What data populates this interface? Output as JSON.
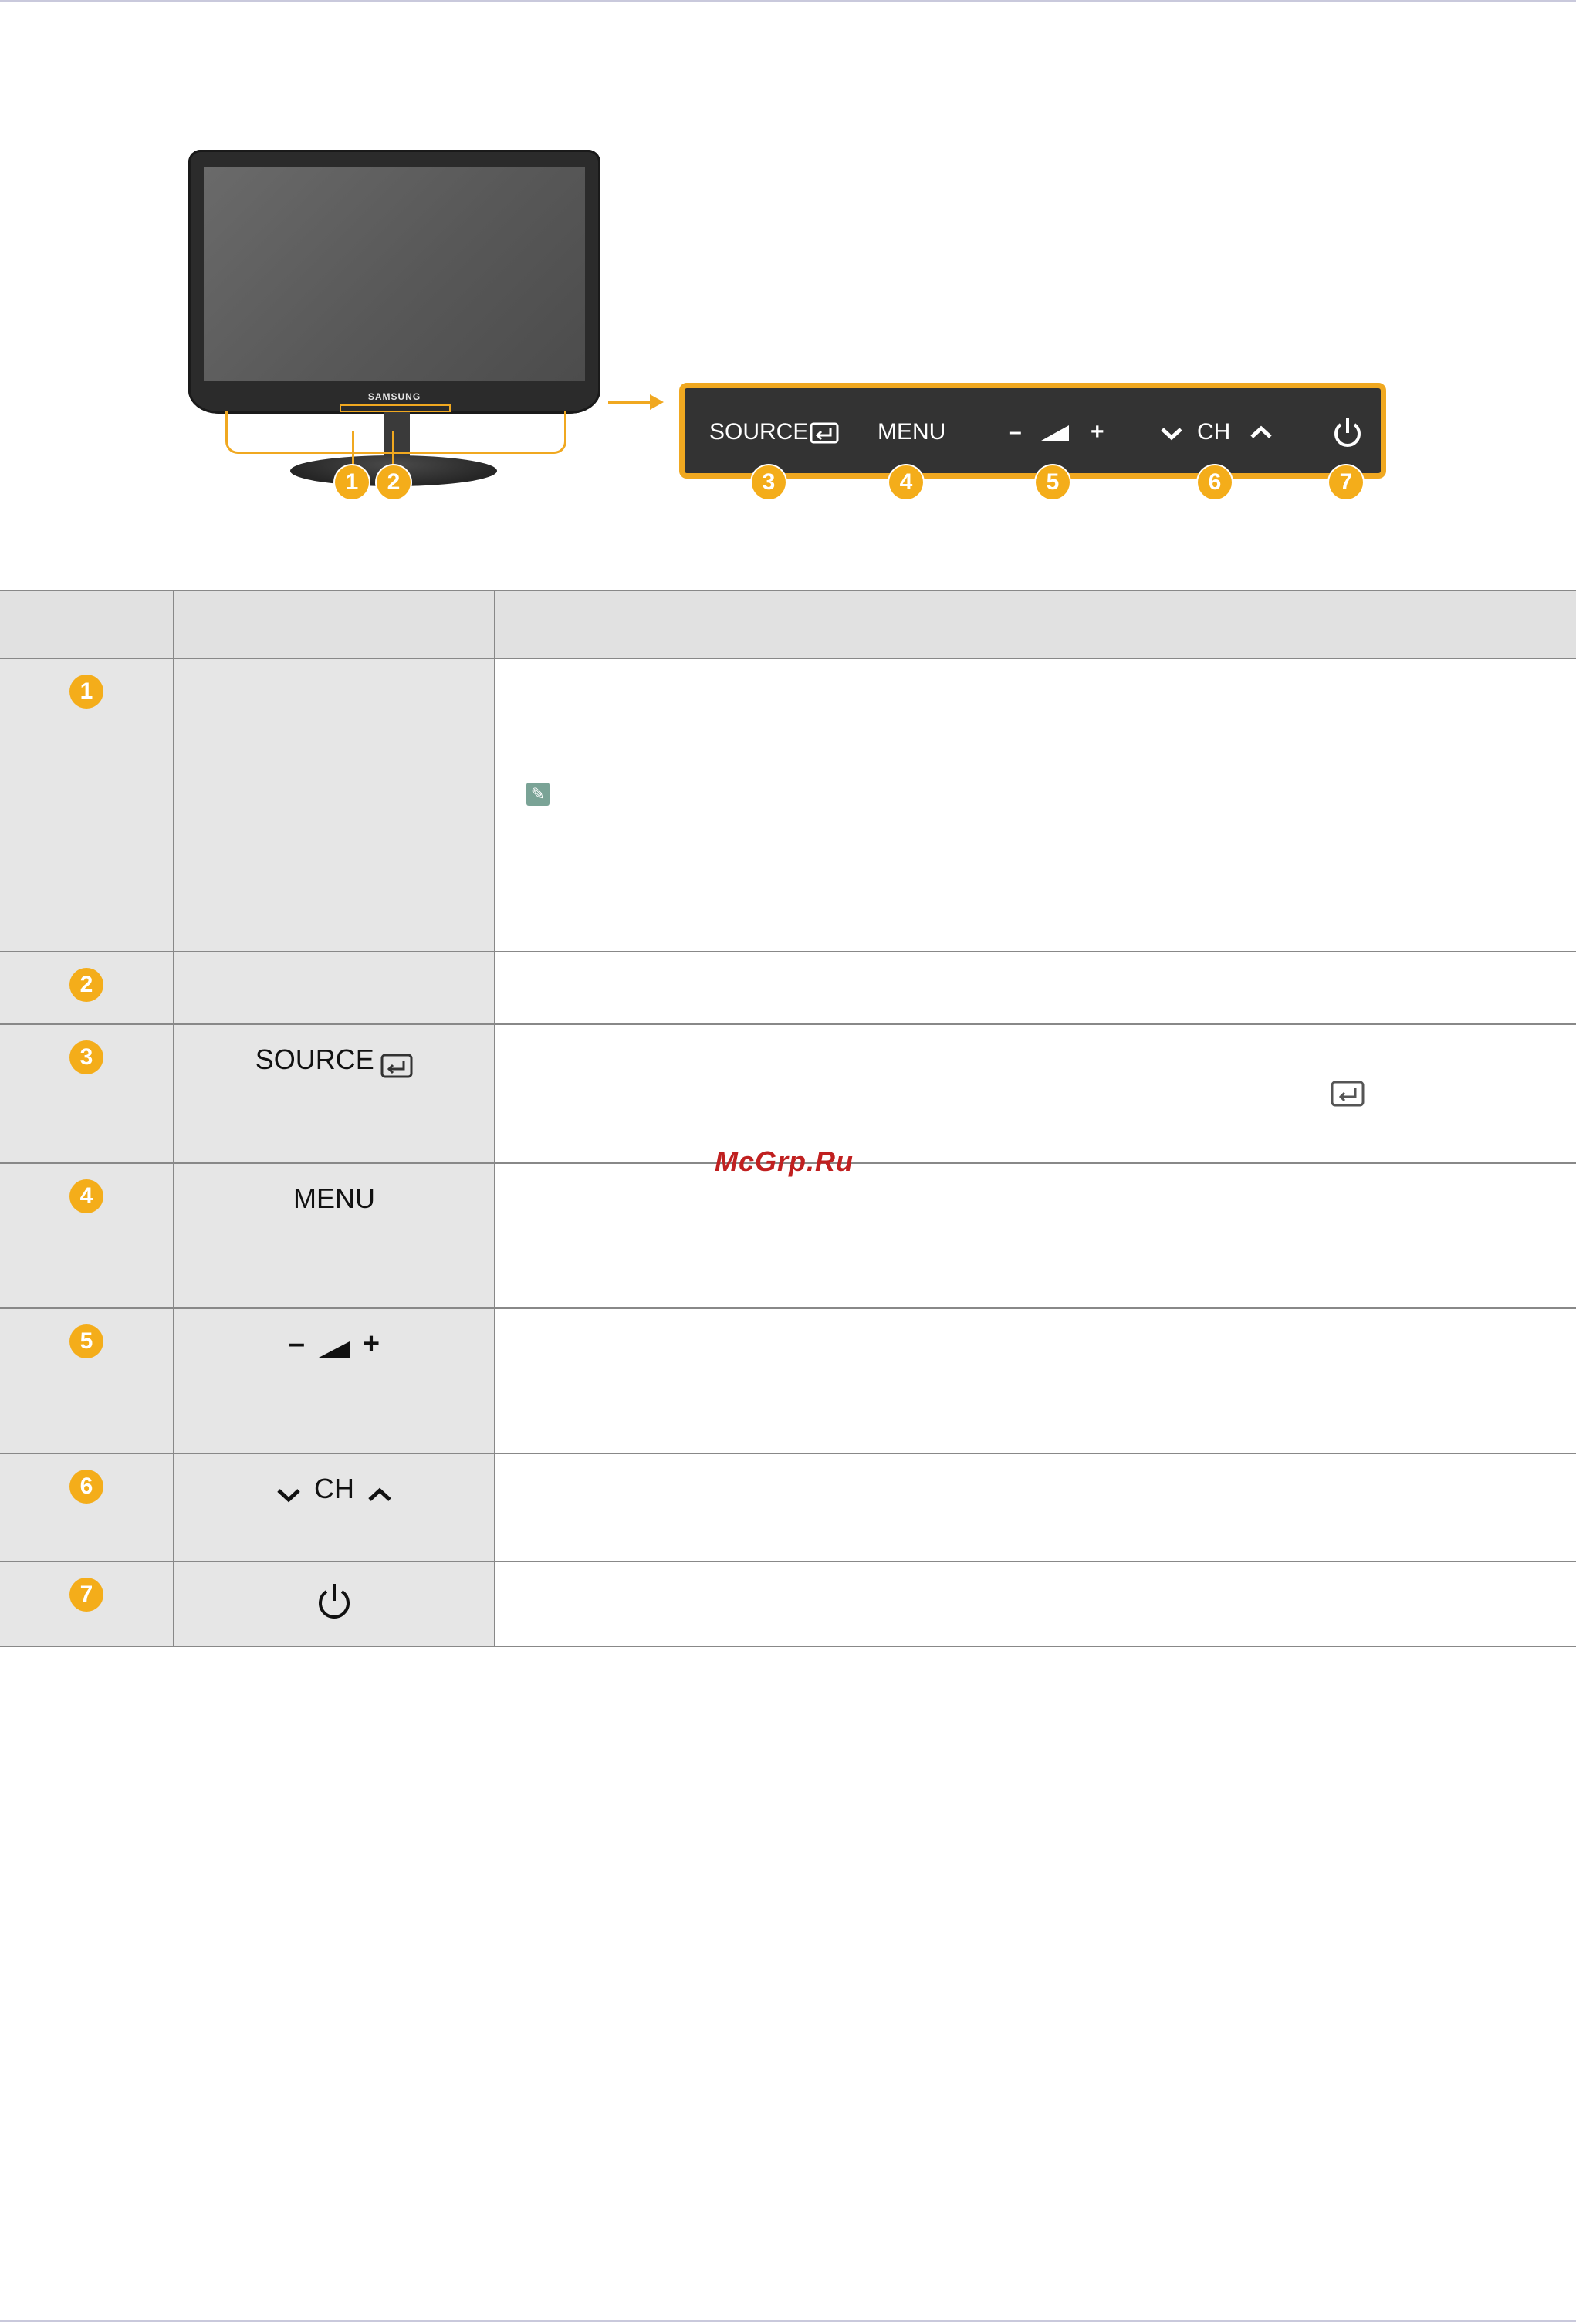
{
  "diagram": {
    "brand": "SAMSUNG",
    "panel": {
      "source": "SOURCE",
      "menu": "MENU",
      "vol_minus": "–",
      "vol_plus": "+",
      "ch": "CH"
    },
    "badges": [
      "1",
      "2",
      "3",
      "4",
      "5",
      "6",
      "7"
    ]
  },
  "table": {
    "rows": [
      {
        "num": "1",
        "label": ""
      },
      {
        "num": "2",
        "label": ""
      },
      {
        "num": "3",
        "label": "SOURCE"
      },
      {
        "num": "4",
        "label": "MENU"
      },
      {
        "num": "5",
        "label_minus": "–",
        "label_plus": "+"
      },
      {
        "num": "6",
        "label_ch": "CH"
      },
      {
        "num": "7",
        "label": ""
      }
    ]
  },
  "watermark": "McGrp.Ru",
  "colors": {
    "accent": "#f4ad1a",
    "panel": "#333333",
    "header_bg": "#e1e1e1",
    "cell_bg": "#e6e6e6",
    "rule": "#c9c9dc"
  },
  "icons": {
    "enter": "enter-icon",
    "volume": "volume-wedge-icon",
    "chevron_down": "chevron-down-icon",
    "chevron_up": "chevron-up-icon",
    "power": "power-icon",
    "note": "note-pencil-icon",
    "input": "input-source-icon"
  }
}
